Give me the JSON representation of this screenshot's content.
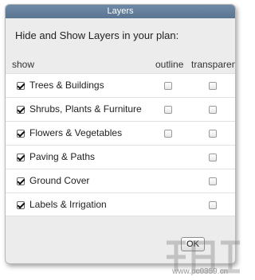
{
  "dialog": {
    "title": "Layers",
    "intro": "Hide and Show Layers in your plan:",
    "columns": {
      "show": "show",
      "outline": "outline",
      "transparent": "transparent"
    },
    "ok_label": "OK"
  },
  "layers": [
    {
      "label": "Trees & Buildings",
      "show": true,
      "outline": false,
      "transparent": false,
      "has_outline": true
    },
    {
      "label": "Shrubs, Plants & Furniture",
      "show": true,
      "outline": false,
      "transparent": false,
      "has_outline": true
    },
    {
      "label": "Flowers & Vegetables",
      "show": true,
      "outline": false,
      "transparent": false,
      "has_outline": true
    },
    {
      "label": "Paving & Paths",
      "show": true,
      "outline": false,
      "transparent": false,
      "has_outline": false
    },
    {
      "label": "Ground Cover",
      "show": true,
      "outline": false,
      "transparent": false,
      "has_outline": false
    },
    {
      "label": "Labels & Irrigation",
      "show": true,
      "outline": false,
      "transparent": false,
      "has_outline": false
    }
  ],
  "watermark": {
    "text": "www.pc0359.cn"
  },
  "colors": {
    "titlebar": "#5f7a96",
    "dialog_bg": "#ececec",
    "row_bg": "#ffffff"
  }
}
